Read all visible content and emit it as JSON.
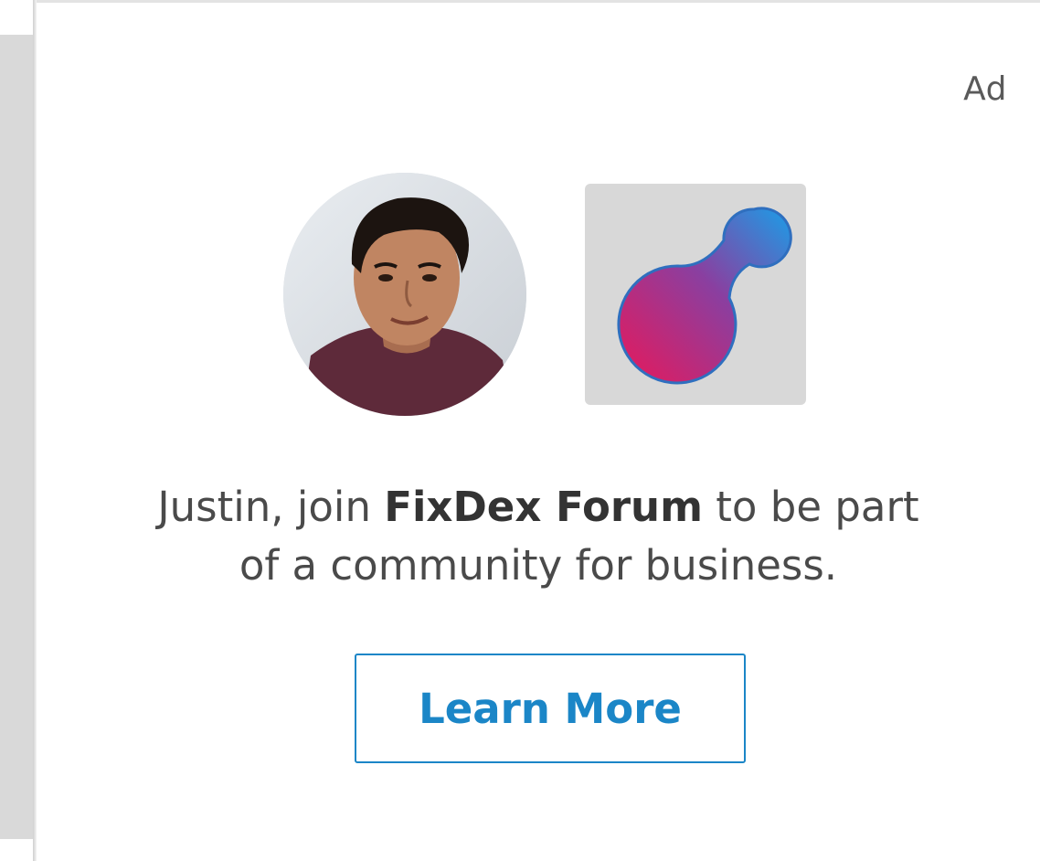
{
  "ad": {
    "label": "Ad",
    "message_prefix": "Justin, join ",
    "company_name": "FixDex Forum",
    "message_middle": " to be part",
    "message_line2": "of a community for business.",
    "cta_label": "Learn More"
  },
  "colors": {
    "accent": "#1b86c7",
    "logo_gradient_start": "#e8185a",
    "logo_gradient_end": "#1a9ee8",
    "side_panel": "#d9d9d9"
  },
  "icons": {
    "avatar": "profile-photo",
    "company_logo": "fixdex-logo"
  }
}
